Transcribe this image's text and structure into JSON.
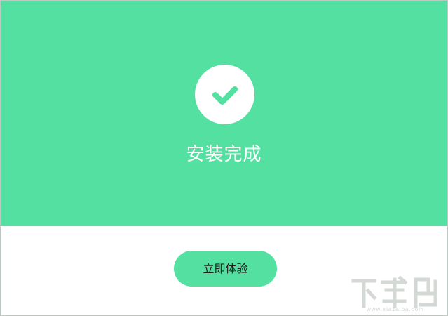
{
  "hero": {
    "status_icon": "check-circle-icon",
    "title": "安装完成",
    "background_color": "#54e0a1",
    "icon_color": "#54e0a1"
  },
  "footer": {
    "primary_button_label": "立即体验",
    "button_color": "#54e0a1",
    "button_text_color": "#222222"
  },
  "watermark": {
    "site_url": "www.xiazaiba.com",
    "logo": "xiazaiba-logo"
  }
}
